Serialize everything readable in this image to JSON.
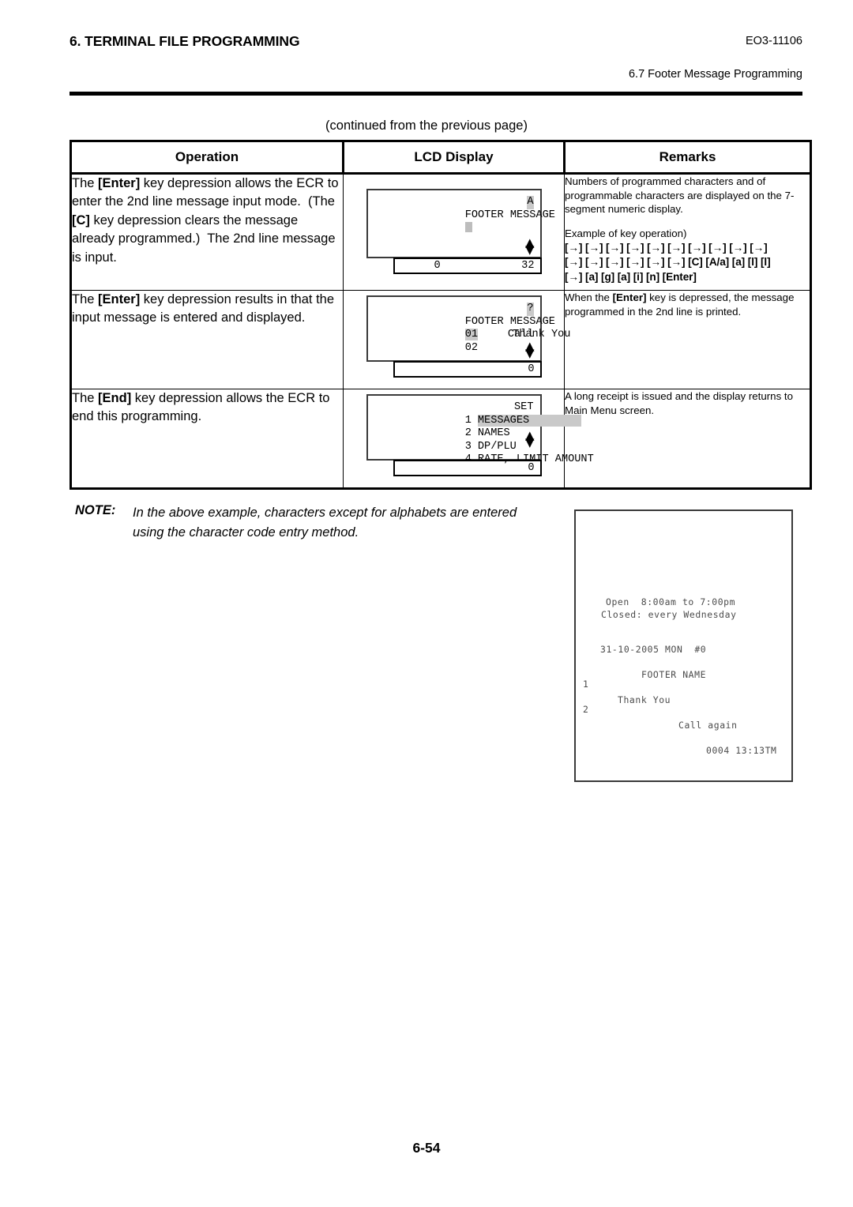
{
  "header": {
    "section_title": "6. TERMINAL FILE PROGRAMMING",
    "doc_code": "EO3-11106",
    "subsection": "6.7 Footer Message Programming"
  },
  "continued_note": "(continued from the previous page)",
  "table": {
    "columns": [
      "Operation",
      "LCD Display",
      "Remarks"
    ],
    "rows": [
      {
        "operation_html": "The <b>[Enter]</b> key depression allows the ECR to enter the 2nd line message input mode.&nbsp; (The <b>[C]</b> key depression clears the message already programmed.)&nbsp; The 2nd line message is input.",
        "lcd": {
          "title": "FOOTER MESSAGE",
          "mode_indicator": "A",
          "cursor": true,
          "lines": [],
          "scroll_arrows": true,
          "seg_left": "0",
          "seg_right": "32"
        },
        "remarks_html": "Numbers of programmed characters and of programmable characters are displayed on the 7-segment numeric display.",
        "remarks_example_label": "Example of key operation)",
        "key_sequence_lines": [
          "[→] [→] [→] [→] [→] [→] [→] [→] [→] [→]",
          "[→] [→] [→] [→] [→] [→] [C] [A/a] [a] [l] [l]",
          "[→] [a] [g] [a] [i] [n] [Enter]"
        ]
      },
      {
        "operation_html": "The <b>[Enter]</b> key depression results in that the input message is entered and displayed.",
        "lcd": {
          "title": "FOOTER MESSAGE",
          "mode_indicator": "?",
          "cursor": false,
          "lines": [
            {
              "number": "01",
              "number_inverted": true,
              "text": "Thank You",
              "align": "center"
            },
            {
              "number": "02",
              "number_inverted": false,
              "text": "Call",
              "align": "right"
            }
          ],
          "scroll_arrows": true,
          "seg_left": "",
          "seg_right": "0"
        },
        "remarks_html": "When the <b>[Enter]</b> key is depressed, the message programmed in the 2nd line is printed.",
        "remarks_example_label": "",
        "key_sequence_lines": []
      },
      {
        "operation_html": "The <b>[End]</b> key depression allows the ECR to end this programming.",
        "lcd": {
          "title": "",
          "mode_indicator": "",
          "cursor": false,
          "menu_items": [
            {
              "number": "1",
              "label": "MESSAGES",
              "selected": true,
              "tag": "SET"
            },
            {
              "number": "2",
              "label": "NAMES",
              "selected": false,
              "tag": ""
            },
            {
              "number": "3",
              "label": "DP/PLU",
              "selected": false,
              "tag": ""
            },
            {
              "number": "4",
              "label": "RATE, LIMIT AMOUNT",
              "selected": false,
              "tag": ""
            }
          ],
          "scroll_arrows": true,
          "seg_left": "",
          "seg_right": "0"
        },
        "remarks_html": "A long receipt is issued and the display returns to Main Menu screen.",
        "remarks_example_label": "",
        "key_sequence_lines": []
      }
    ]
  },
  "note": {
    "label": "NOTE:",
    "text": "In the above example, characters except for alphabets are entered using the character code entry method."
  },
  "receipt": {
    "lines": [
      "Open  8:00am to 7:00pm",
      "Closed: every Wednesday",
      "31-10-2005 MON  #0",
      "FOOTER NAME",
      "1",
      "Thank You",
      "2",
      "Call again",
      "0004 13:13TM"
    ],
    "open_hours": "Open  8:00am to 7:00pm",
    "closed_note": "Closed: every Wednesday",
    "date_line": "31-10-2005 MON  #0",
    "footer_name": "FOOTER NAME",
    "line1_number": "1",
    "line1_text": "Thank You",
    "line2_number": "2",
    "line2_text": "Call again",
    "trailer": "0004 13:13TM"
  },
  "page_number": "6-54"
}
